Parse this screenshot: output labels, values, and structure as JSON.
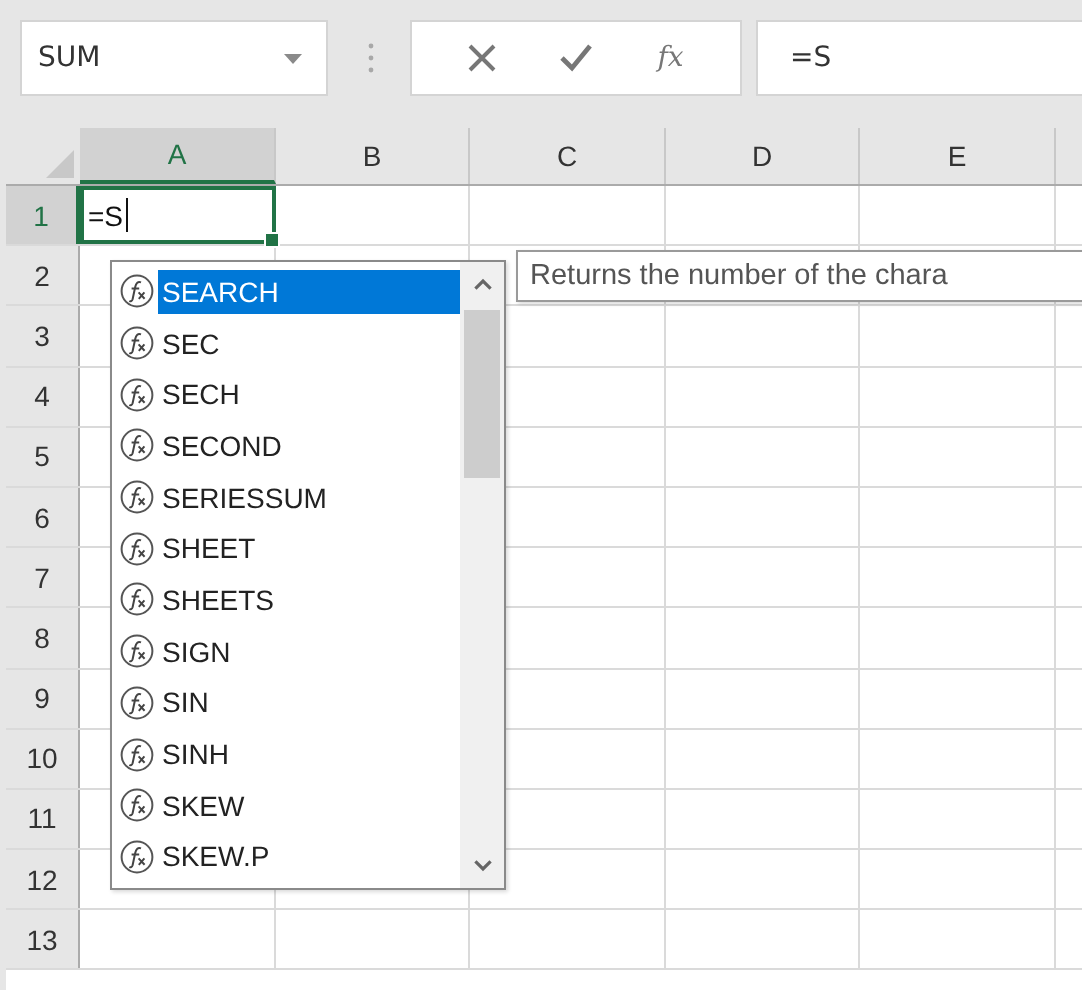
{
  "name_box": {
    "value": "SUM"
  },
  "formula_buttons": [
    {
      "kind": "cancel"
    },
    {
      "kind": "enter"
    },
    {
      "kind": "insert_function",
      "label": "fx"
    }
  ],
  "formula_bar": {
    "value": "=S"
  },
  "columns": [
    {
      "label": "A",
      "selected": true
    },
    {
      "label": "B",
      "selected": false
    },
    {
      "label": "C",
      "selected": false
    },
    {
      "label": "D",
      "selected": false
    },
    {
      "label": "E",
      "selected": false
    }
  ],
  "rows": [
    {
      "label": "1",
      "selected": true
    },
    {
      "label": "2",
      "selected": false
    },
    {
      "label": "3",
      "selected": false
    },
    {
      "label": "4",
      "selected": false
    },
    {
      "label": "5",
      "selected": false
    },
    {
      "label": "6",
      "selected": false
    },
    {
      "label": "7",
      "selected": false
    },
    {
      "label": "8",
      "selected": false
    },
    {
      "label": "9",
      "selected": false
    },
    {
      "label": "10",
      "selected": false
    },
    {
      "label": "11",
      "selected": false
    },
    {
      "label": "12",
      "selected": false
    },
    {
      "label": "13",
      "selected": false
    }
  ],
  "active_cell": {
    "value": "=S"
  },
  "autocomplete": {
    "items": [
      {
        "label": "SEARCH",
        "selected": true
      },
      {
        "label": "SEC",
        "selected": false
      },
      {
        "label": "SECH",
        "selected": false
      },
      {
        "label": "SECOND",
        "selected": false
      },
      {
        "label": "SERIESSUM",
        "selected": false
      },
      {
        "label": "SHEET",
        "selected": false
      },
      {
        "label": "SHEETS",
        "selected": false
      },
      {
        "label": "SIGN",
        "selected": false
      },
      {
        "label": "SIN",
        "selected": false
      },
      {
        "label": "SINH",
        "selected": false
      },
      {
        "label": "SKEW",
        "selected": false
      },
      {
        "label": "SKEW.P",
        "selected": false
      }
    ]
  },
  "tooltip": {
    "text": "Returns the number of the chara"
  }
}
